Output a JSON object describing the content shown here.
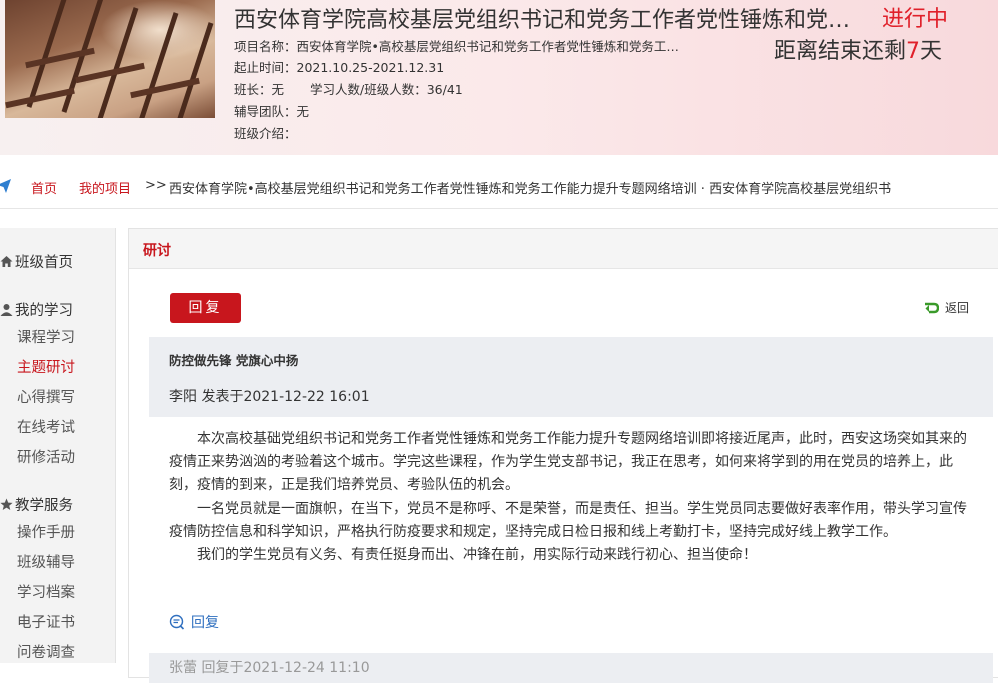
{
  "header": {
    "title": "西安体育学院高校基层党组织书记和党务工作者党性锤炼和党务工作能力提升专题网络培训",
    "status": "进行中",
    "countdown_prefix": "距离结束还剩",
    "countdown_days": "7",
    "countdown_suffix": "天",
    "project_name": "项目名称：西安体育学院•高校基层党组织书记和党务工作者党性锤炼和党务工作能力提升专题网络培训",
    "date_range": "起止时间：2021.10.25-2021.12.31",
    "class_leader": "班长：无",
    "learners": "学习人数/班级人数：36/41",
    "tutor_team": "辅导团队：无",
    "class_intro": "班级介绍："
  },
  "breadcrumb": {
    "home": "首页",
    "my_projects": "我的项目",
    "separator": ">>",
    "path": "西安体育学院•高校基层党组织书记和党务工作者党性锤炼和党务工作能力提升专题网络培训 · 西安体育学院高校基层党组织书"
  },
  "sidebar": {
    "class_home": "班级首页",
    "my_learning": {
      "label": "我的学习",
      "items": [
        "课程学习",
        "主题研讨",
        "心得撰写",
        "在线考试",
        "研修活动"
      ]
    },
    "teaching_service": {
      "label": "教学服务",
      "items": [
        "操作手册",
        "班级辅导",
        "学习档案",
        "电子证书",
        "问卷调查"
      ]
    },
    "active_item": "主题研讨"
  },
  "panel": {
    "title": "研讨",
    "reply_button": "回复",
    "back_link": "返回"
  },
  "post": {
    "topic": "防控做先锋 党旗心中扬",
    "meta": "李阳 发表于2021-12-22 16:01",
    "paragraphs": [
      "本次高校基础党组织书记和党务工作者党性锤炼和党务工作能力提升专题网络培训即将接近尾声，此时，西安这场突如其来的疫情正来势汹汹的考验着这个城市。学完这些课程，作为学生党支部书记，我正在思考，如何来将学到的用在党员的培养上，此刻，疫情的到来，正是我们培养党员、考验队伍的机会。",
      "一名党员就是一面旗帜，在当下，党员不是称呼、不是荣誉，而是责任、担当。学生党员同志要做好表率作用，带头学习宣传疫情防控信息和科学知识，严格执行防疫要求和规定，坚持完成日检日报和线上考勤打卡，坚持完成好线上教学工作。",
      "我们的学生党员有义务、有责任挺身而出、冲锋在前，用实际行动来践行初心、担当使命！"
    ],
    "reply_link": "回复"
  },
  "next_post": {
    "meta": "张蕾 回复于2021-12-24 11:10"
  },
  "colors": {
    "accent_red": "#c8161d",
    "link_blue": "#2f6fbf",
    "header_bg": "#fbe9ea"
  }
}
